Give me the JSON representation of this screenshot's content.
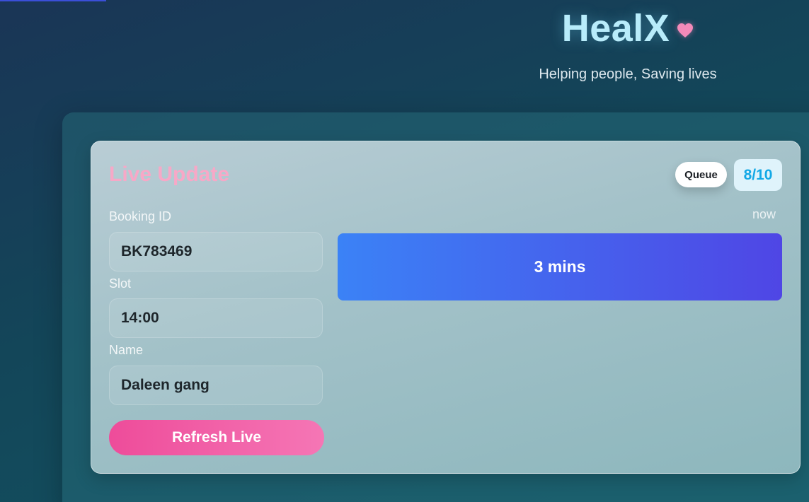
{
  "brand": {
    "title": "HealX",
    "tagline": "Helping people, Saving lives",
    "icon": "heart-icon",
    "heart_color": "#f48ab9"
  },
  "live_update": {
    "title": "Live Update",
    "queue_label": "Queue",
    "queue_count": "8/10",
    "timestamp": "now",
    "wait_time": "3 mins",
    "fields": {
      "booking_id": {
        "label": "Booking ID",
        "value": "BK783469"
      },
      "slot": {
        "label": "Slot",
        "value": "14:00"
      },
      "name": {
        "label": "Name",
        "value": "Daleen gang"
      }
    },
    "refresh_label": "Refresh Live"
  },
  "colors": {
    "title_pink": "#f7a8c7",
    "queue_blue": "#12a8e6",
    "button_pink": "#ee4c9a",
    "bar_blue": "#3b82f6",
    "bar_indigo": "#4f46e5"
  }
}
